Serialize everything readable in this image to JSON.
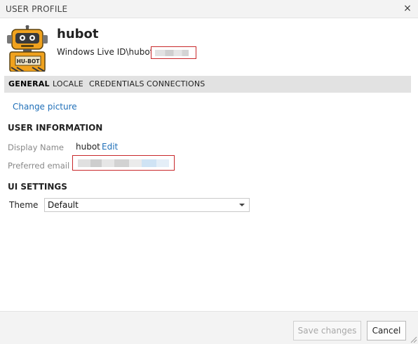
{
  "window": {
    "title": "USER PROFILE",
    "close_glyph": "×"
  },
  "header": {
    "avatar_icon": "hubot-robot-avatar",
    "avatar_badge": "HU-BOT",
    "user_name": "hubot",
    "account_prefix": "Windows Live ID\\hubot@"
  },
  "tabs": [
    {
      "label": "GENERAL",
      "active": true
    },
    {
      "label": "LOCALE"
    },
    {
      "label": "CREDENTIALS"
    },
    {
      "label": "CONNECTIONS"
    }
  ],
  "general": {
    "change_picture": "Change picture",
    "user_info_heading": "USER INFORMATION",
    "display_name_label": "Display Name",
    "display_name_value": "hubot",
    "edit_link": "Edit",
    "preferred_email_label": "Preferred email",
    "ui_settings_heading": "UI SETTINGS",
    "theme_label": "Theme",
    "theme_value": "Default"
  },
  "footer": {
    "save_label": "Save changes",
    "cancel_label": "Cancel"
  },
  "colors": {
    "link": "#1f6fb8",
    "redaction_border": "#c8282b",
    "tab_bar": "#e2e2e2"
  }
}
